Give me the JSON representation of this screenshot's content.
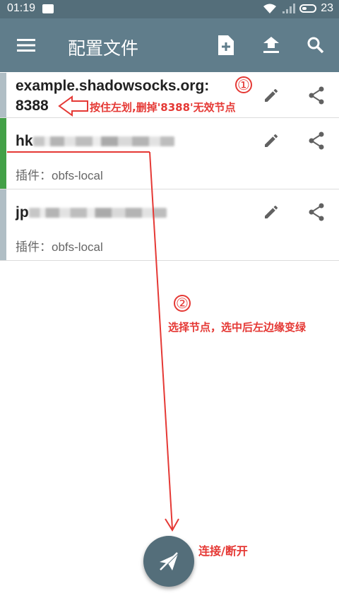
{
  "status_bar": {
    "time": "01:19",
    "battery_level": "23"
  },
  "toolbar": {
    "title": "配置文件",
    "icons": [
      "menu-icon",
      "add-file-icon",
      "upload-icon",
      "search-icon"
    ]
  },
  "profiles": [
    {
      "name_line1": "example.shadowsocks.org:",
      "name_line2": "8388",
      "selected": false
    },
    {
      "name_prefix": "hk",
      "plugin_label": "插件：",
      "plugin": "obfs-local",
      "selected": true
    },
    {
      "name_prefix": "jp",
      "plugin_label": "插件：",
      "plugin": "obfs-local",
      "selected": false
    }
  ],
  "annotations": {
    "marker1": "①",
    "note1": "按住左划,删掉'8388'无效节点",
    "marker2": "②",
    "note2": "选择节点，选中后左边缘变绿",
    "note3": "连接/断开"
  },
  "colors": {
    "toolbar": "#607d8b",
    "status_bar": "#546e7a",
    "selected_edge": "#43a047",
    "unselected_edge": "#b0bec5",
    "annotation": "#e53935"
  }
}
